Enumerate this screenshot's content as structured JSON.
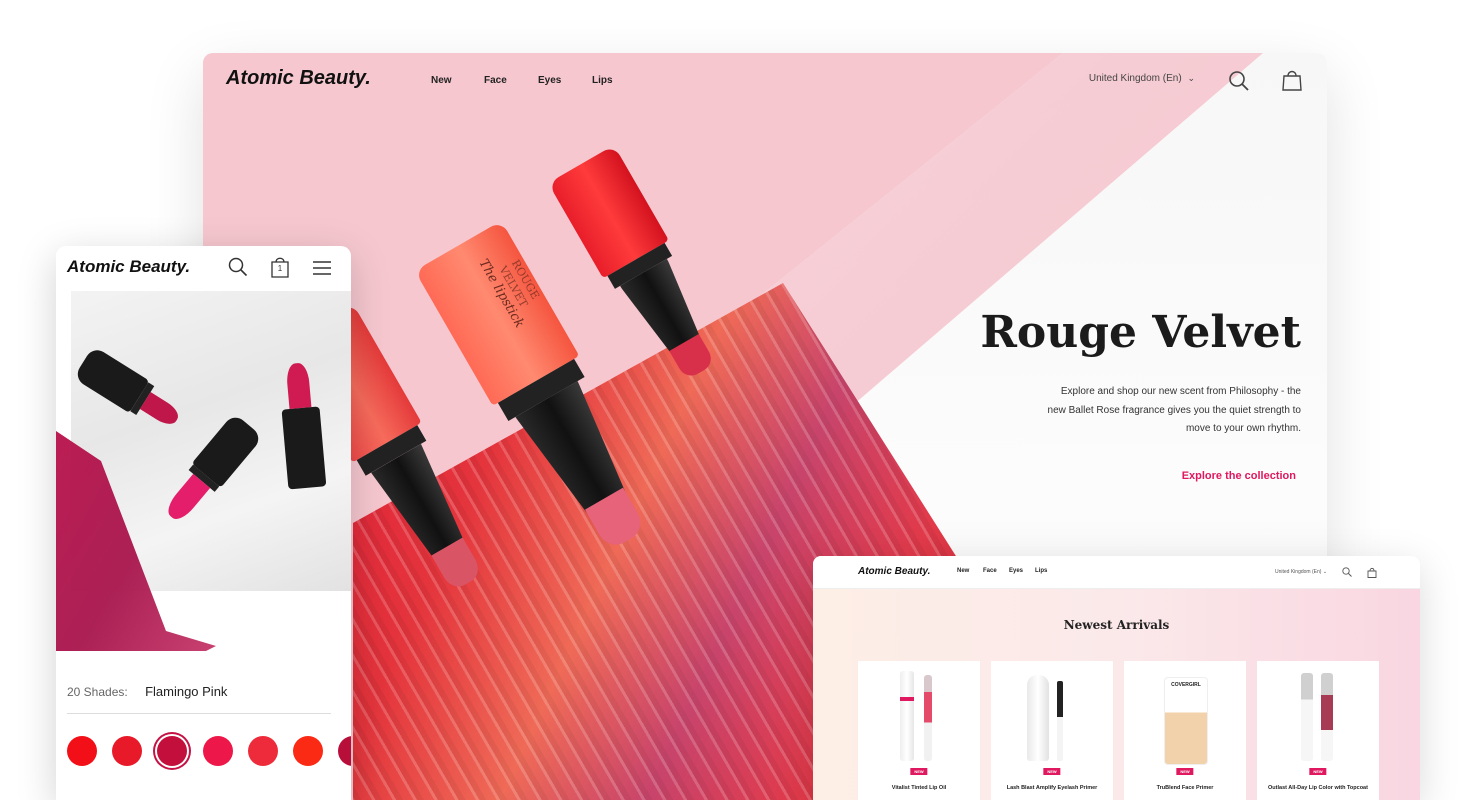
{
  "desktop": {
    "brand": "Atomic Beauty.",
    "nav": [
      "New",
      "Face",
      "Eyes",
      "Lips"
    ],
    "region": "United Kingdom (En)",
    "hero": {
      "title": "Rouge Velvet",
      "description": "Explore and shop our new scent from Philosophy - the new Ballet Rose fragrance gives you the quiet strength to move to your own rhythm.",
      "cta": "Explore the collection"
    },
    "product_text": {
      "line1": "ROUGE VELVET",
      "line2": "The lipstick"
    }
  },
  "mobile": {
    "brand": "Atomic Beauty.",
    "cart_count": "1",
    "shades_label": "20 Shades:",
    "selected_shade": "Flamingo Pink",
    "swatches": [
      "#f20f17",
      "#e81a2a",
      "#c20f3c",
      "#ee1749",
      "#ee2b3a",
      "#fb2a14",
      "#b80f3a"
    ]
  },
  "small_desktop": {
    "brand": "Atomic Beauty.",
    "nav": [
      "New",
      "Face",
      "Eyes",
      "Lips"
    ],
    "region": "United Kingdom (En)",
    "section_title": "Newest Arrivals",
    "products": [
      {
        "name": "Vitalist Tinted Lip Oil",
        "badge": "NEW"
      },
      {
        "name": "Lash Blast Amplify Eyelash Primer",
        "badge": "NEW"
      },
      {
        "name": "TruBlend Face Primer",
        "badge": "NEW",
        "brand_label": "COVERGIRL"
      },
      {
        "name": "Outlast All-Day Lip Color with Topcoat",
        "badge": "NEW"
      }
    ]
  },
  "colors": {
    "accent": "#e0185f",
    "pink_bg": "#f6c7cf",
    "text_dark": "#1b1b1b"
  }
}
